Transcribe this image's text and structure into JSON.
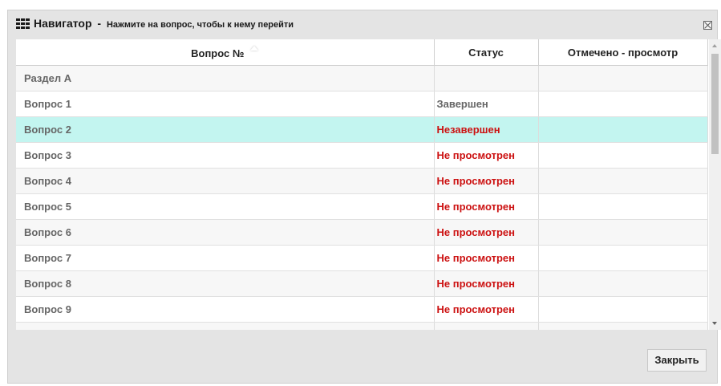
{
  "dialog": {
    "title": "Навигатор",
    "separator": "-",
    "subtitle": "Нажмите на вопрос, чтобы к нему перейти"
  },
  "table": {
    "columns": [
      "Вопрос №",
      "Статус",
      "Отмечено - просмотр"
    ],
    "rows": [
      {
        "question": "Раздел А",
        "status": "",
        "marked": ""
      },
      {
        "question": "Вопрос 1",
        "status": "Завершен",
        "marked": ""
      },
      {
        "question": "Вопрос 2",
        "status": "Незавершен",
        "marked": ""
      },
      {
        "question": "Вопрос 3",
        "status": "Не просмотрен",
        "marked": ""
      },
      {
        "question": "Вопрос 4",
        "status": "Не просмотрен",
        "marked": ""
      },
      {
        "question": "Вопрос 5",
        "status": "Не просмотрен",
        "marked": ""
      },
      {
        "question": "Вопрос 6",
        "status": "Не просмотрен",
        "marked": ""
      },
      {
        "question": "Вопрос 7",
        "status": "Не просмотрен",
        "marked": ""
      },
      {
        "question": "Вопрос 8",
        "status": "Не просмотрен",
        "marked": ""
      },
      {
        "question": "Вопрос 9",
        "status": "Не просмотрен",
        "marked": ""
      },
      {
        "question": "",
        "status": "",
        "marked": ""
      }
    ]
  },
  "selected_row": 2,
  "colors": {
    "status_complete": "#666666",
    "status_incomplete": "#cc1111",
    "selected_row_bg": "#c3f5f0"
  },
  "icons": {
    "title": "grid-icon",
    "close": "close-icon",
    "sort": "sort-ascending-icon",
    "scroll_up": "scroll-up-icon",
    "scroll_down": "scroll-down-icon"
  },
  "buttons": {
    "close": "Закрыть"
  }
}
